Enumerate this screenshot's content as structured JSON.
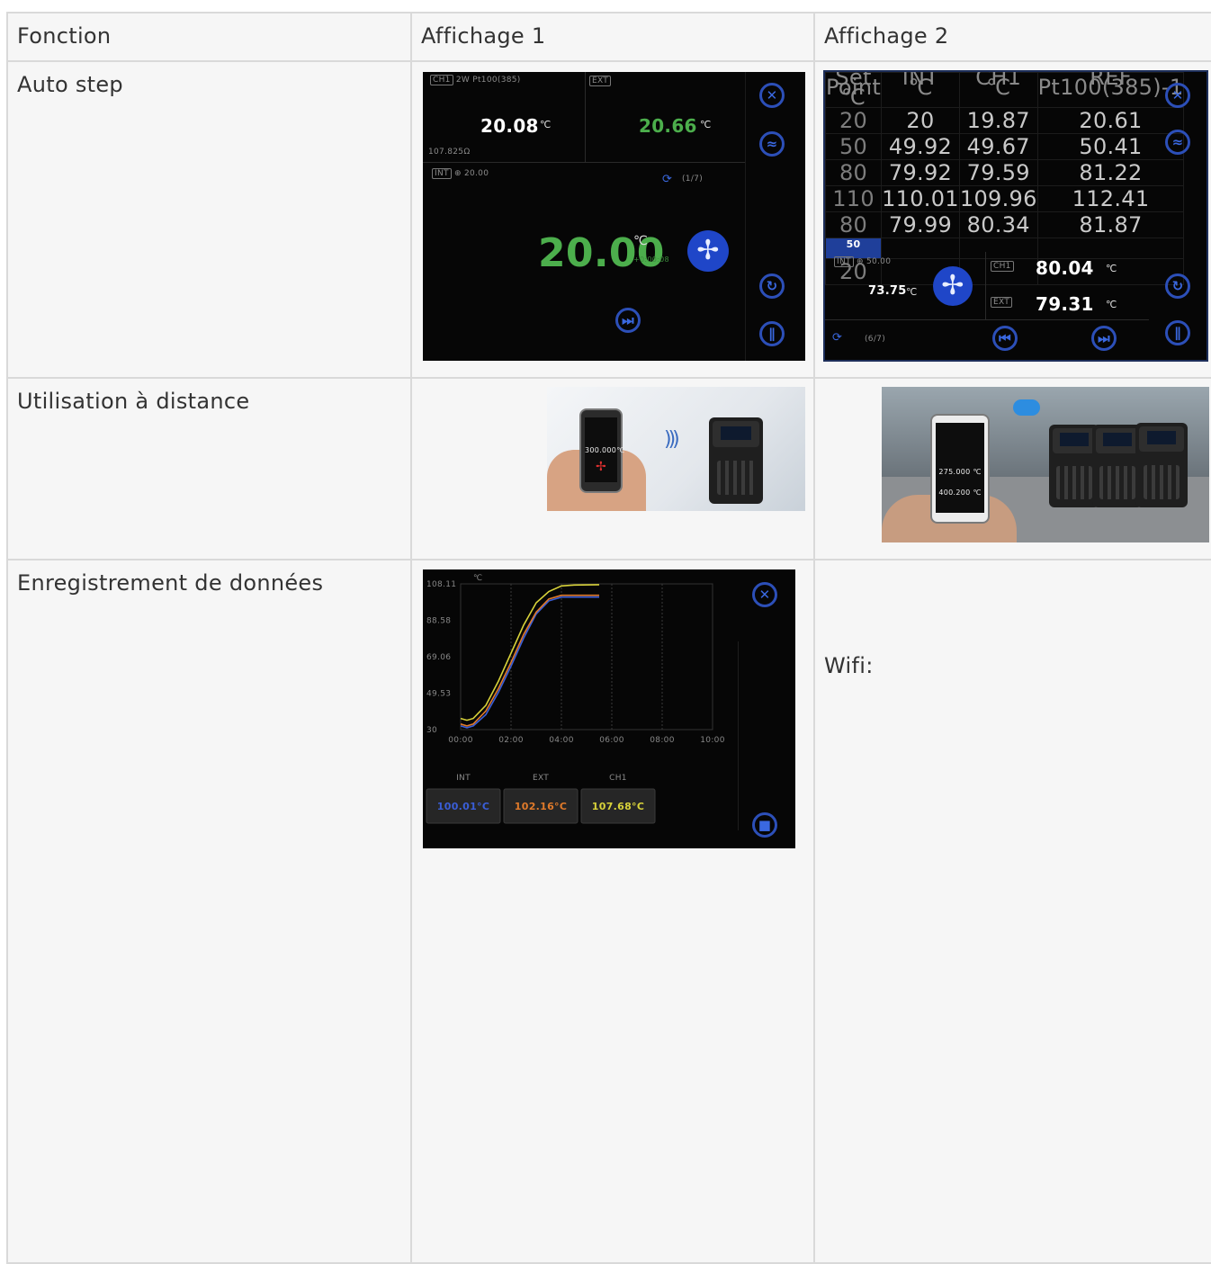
{
  "table": {
    "headers": [
      "Fonction",
      "Affichage 1",
      "Affichage 2"
    ],
    "rows": [
      {
        "label": "Auto step"
      },
      {
        "label": "Utilisation à distance"
      },
      {
        "label": "Enregistrement de données",
        "col3_text": "Wifi:"
      }
    ]
  },
  "autostep_display1": {
    "ch1_tag": "CH1",
    "ch1_sensor": "2W Pt100(385)",
    "ext_tag": "EXT",
    "ch1_value": "20.08",
    "ext_value": "20.66",
    "unit": "℃",
    "resistance": "107.825Ω",
    "int_tag": "INT",
    "int_setpoint": "20.00",
    "step_counter": "(1/7)",
    "main_value": "20.00",
    "main_unit": "℃",
    "timer": "+0:00:08"
  },
  "autostep_display2": {
    "columns": [
      "Set Point\n℃",
      "INT\n℃",
      "CH1\n℃",
      "REF\nPt100(385)-1"
    ],
    "rows": [
      [
        "20",
        "20",
        "19.87",
        "20.61"
      ],
      [
        "50",
        "49.92",
        "49.67",
        "50.41"
      ],
      [
        "80",
        "79.92",
        "79.59",
        "81.22"
      ],
      [
        "110",
        "110.01",
        "109.96",
        "112.41"
      ],
      [
        "80",
        "79.99",
        "80.34",
        "81.87"
      ],
      [
        "50",
        "",
        "",
        ""
      ],
      [
        "20",
        "",
        "",
        ""
      ]
    ],
    "highlight_row": 5,
    "int_tag": "INT",
    "int_setpoint": "50.00",
    "int_value": "73.75",
    "int_unit": "℃",
    "ch1_tag": "CH1",
    "ch1_value": "80.04",
    "ext_tag": "EXT",
    "ext_value": "79.31",
    "unit": "℃",
    "step_counter": "(6/7)"
  },
  "remote_photo1": {
    "phone_value": "300.000℃"
  },
  "remote_photo2": {
    "phone_value": "275.000 ℃",
    "phone_value2": "400.200 ℃"
  },
  "chart_data": {
    "type": "line",
    "ylabel": "℃",
    "ylim": [
      30,
      108.11
    ],
    "y_ticks": [
      "108.11",
      "88.58",
      "69.06",
      "49.53",
      "30"
    ],
    "x_ticks": [
      "00:00",
      "02:00",
      "04:00",
      "06:00",
      "08:00",
      "10:00"
    ],
    "x": [
      0,
      0.25,
      0.5,
      1,
      1.5,
      2,
      2.5,
      3,
      3.5,
      4,
      4.5,
      5.5
    ],
    "series": [
      {
        "name": "INT",
        "color": "#3a5ed8",
        "values": [
          32,
          31,
          32,
          38,
          50,
          64,
          79,
          92,
          99,
          101,
          101,
          101
        ]
      },
      {
        "name": "EXT",
        "color": "#e07a2a",
        "values": [
          33,
          32,
          33,
          40,
          52,
          66,
          81,
          93,
          100,
          102,
          102,
          102
        ]
      },
      {
        "name": "CH1",
        "color": "#d8d23a",
        "values": [
          36,
          35,
          36,
          43,
          56,
          71,
          86,
          98,
          104,
          107,
          107.5,
          107.7
        ]
      }
    ],
    "legend": [
      {
        "name": "INT",
        "value": "100.01°C",
        "color": "#3a5ed8"
      },
      {
        "name": "EXT",
        "value": "102.16°C",
        "color": "#e07a2a"
      },
      {
        "name": "CH1",
        "value": "107.68°C",
        "color": "#d8d23a"
      }
    ]
  }
}
